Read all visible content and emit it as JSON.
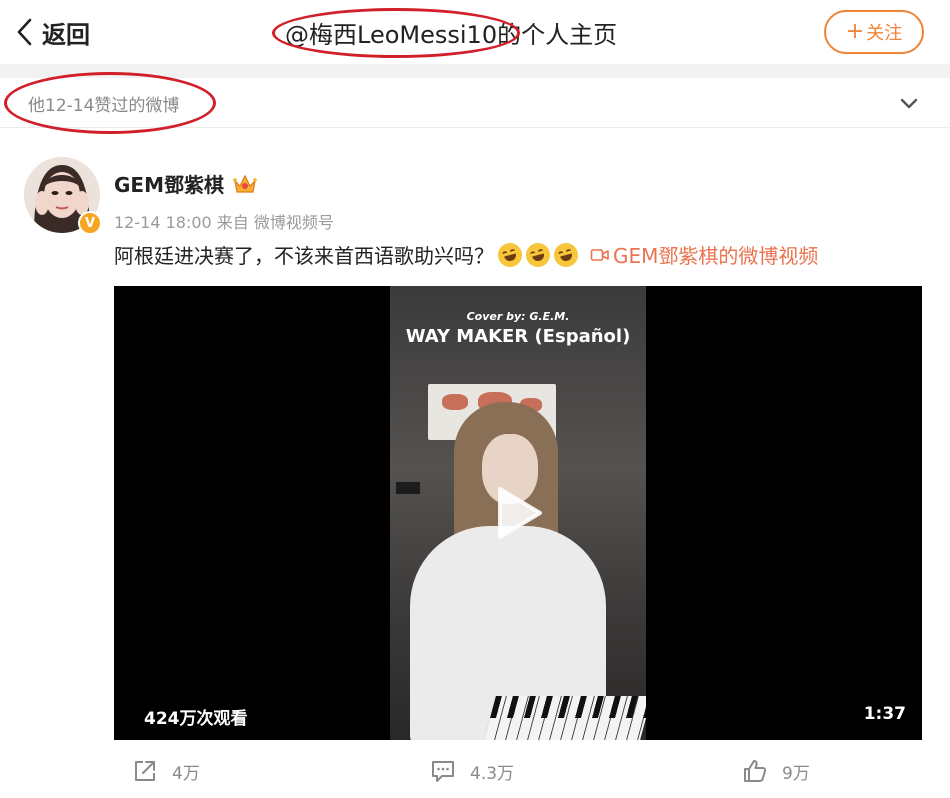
{
  "header": {
    "back_label": "返回",
    "title": "@梅西LeoMessi10的个人主页",
    "follow_label": "关注",
    "follow_plus": "+"
  },
  "liked_section": {
    "label": "他12-14赞过的微博"
  },
  "post": {
    "author": "GEM鄧紫棋",
    "verified_badge": "V",
    "meta": "12-14 18:00  来自 微博视频号",
    "text": "阿根廷进决赛了，不该来首西语歌助兴吗？",
    "emoji_icons": [
      "rolling-on-floor-laughing-icon",
      "rolling-on-floor-laughing-icon",
      "rolling-on-floor-laughing-icon"
    ],
    "video_link_label": "GEM鄧紫棋的微博视频",
    "video": {
      "cover_by": "Cover by: G.E.M.",
      "song_title": "WAY MAKER (Español)",
      "views": "424万次观看",
      "duration": "1:37"
    },
    "actions": {
      "repost_count": "4万",
      "comment_count": "4.3万",
      "like_count": "9万"
    }
  },
  "colors": {
    "accent_orange": "#f08437",
    "link_orange": "#eb7350",
    "annotation_red": "#d11f2a",
    "muted_gray": "#8a8a8a"
  }
}
